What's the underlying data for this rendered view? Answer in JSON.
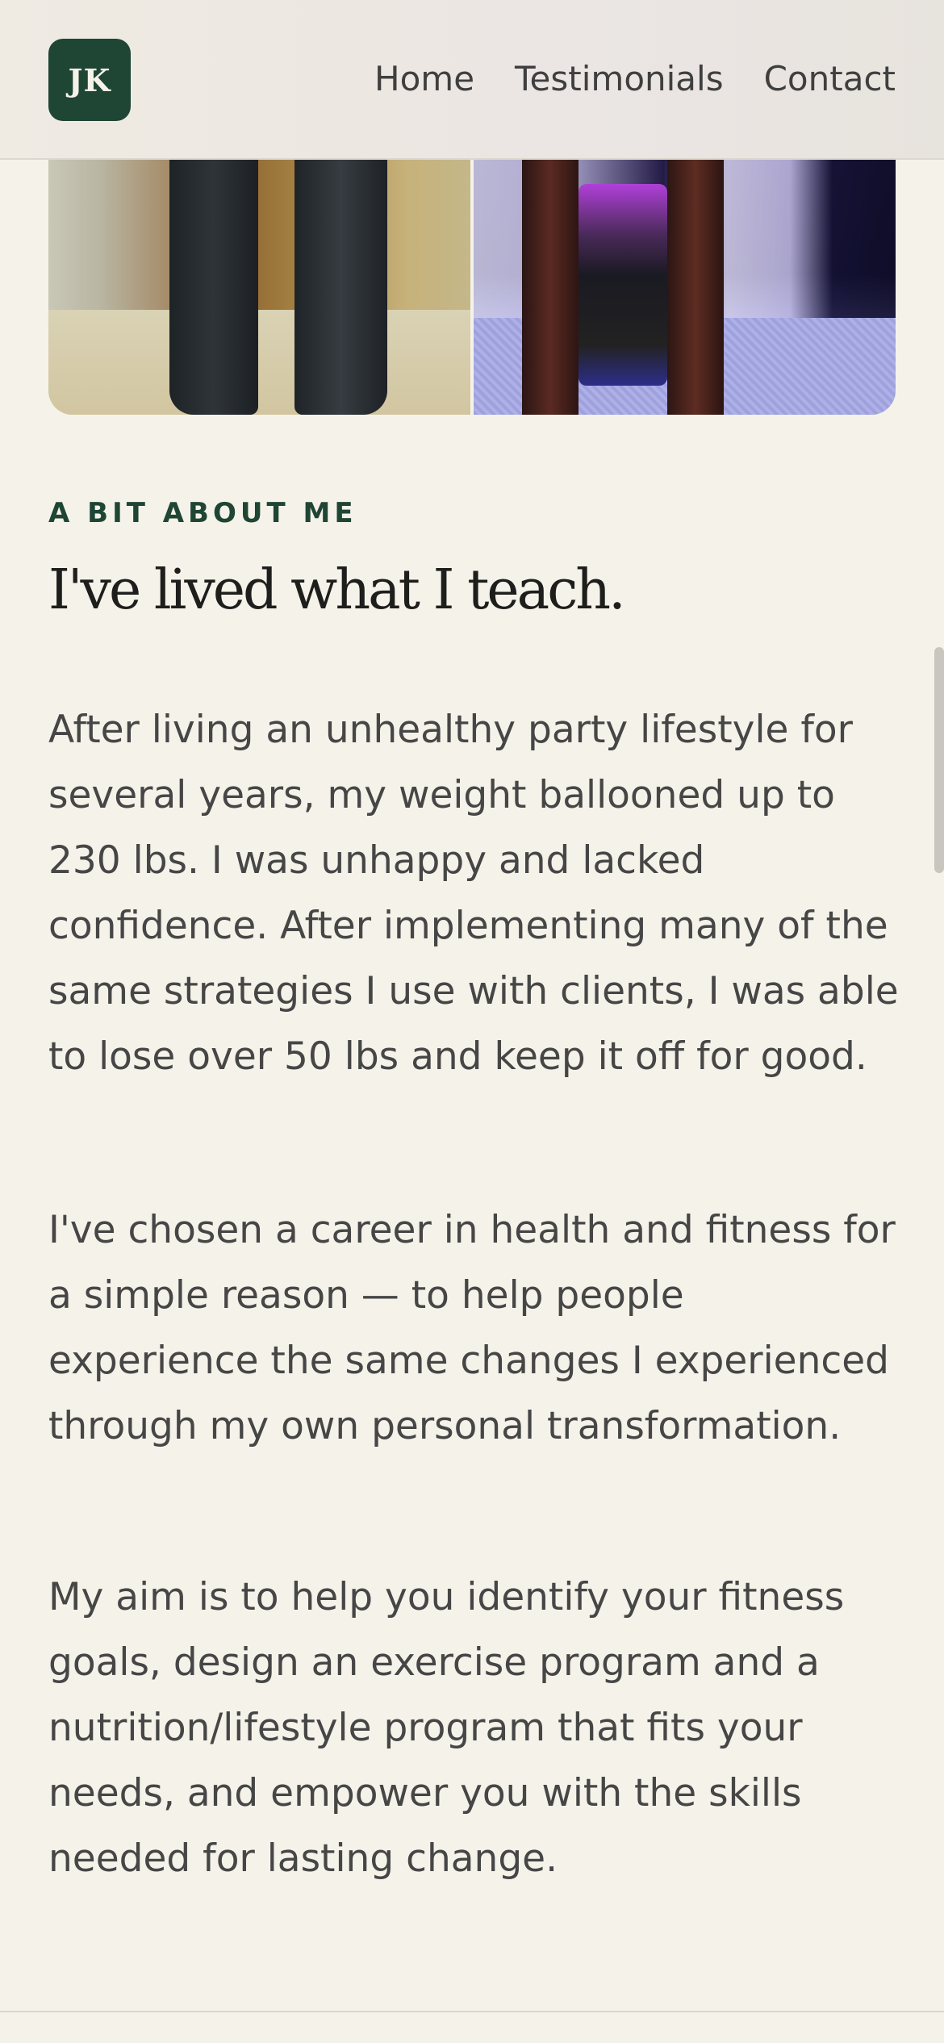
{
  "header": {
    "logo_text": "JK",
    "nav": [
      "Home",
      "Testimonials",
      "Contact"
    ]
  },
  "about": {
    "eyebrow": "A BIT ABOUT ME",
    "heading": "I've lived what I teach.",
    "paragraphs": [
      "After living an unhealthy party lifestyle for several years, my weight ballooned up to 230 lbs. I was unhappy and lacked confidence. After implementing many of the same strategies I use with clients, I was able to lose over 50 lbs and keep it off for good.",
      "I've chosen a career in health and fitness for a simple reason — to help people experience the same changes I experienced through my own personal transformation.",
      "My aim is to help you identify your fitness goals, design an exercise program and a nutrition/lifestyle program that fits your needs, and empower you with the skills needed for lasting change."
    ]
  },
  "colors": {
    "brand_green": "#1f4534",
    "background": "#f5f2e9",
    "text": "#464646"
  }
}
